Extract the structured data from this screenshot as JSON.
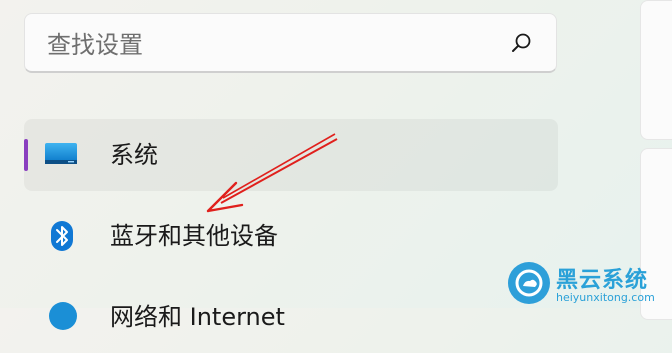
{
  "search": {
    "placeholder": "查找设置",
    "icon": "search-icon"
  },
  "nav": {
    "items": [
      {
        "label": "系统",
        "icon": "monitor-icon",
        "selected": true,
        "indicator_color": "#8a3fbf"
      },
      {
        "label": "蓝牙和其他设备",
        "icon": "bluetooth-icon",
        "selected": false
      },
      {
        "label": "网络和 Internet",
        "icon": "network-icon",
        "selected": false
      }
    ]
  },
  "annotation": {
    "type": "red-arrow",
    "color": "#e0201c"
  },
  "watermark": {
    "title": "黑云系统",
    "subtitle": "heiyunxitong.com",
    "color": "#2aa1d8"
  }
}
